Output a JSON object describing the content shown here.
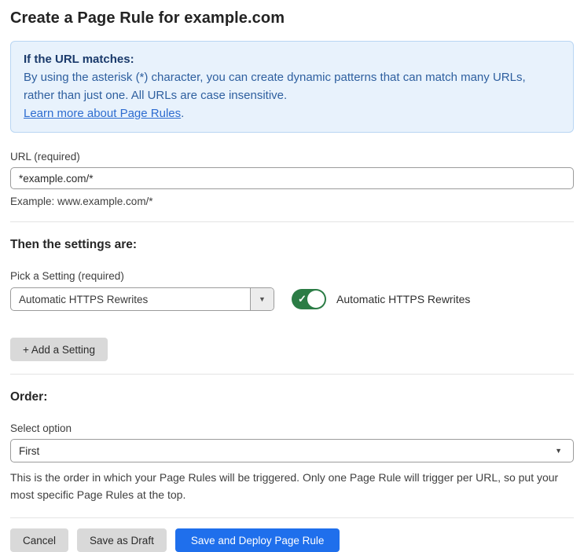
{
  "page": {
    "title": "Create a Page Rule for example.com"
  },
  "info_box": {
    "heading": "If the URL matches:",
    "body": "By using the asterisk (*) character, you can create dynamic patterns that can match many URLs, rather than just one. All URLs are case insensitive.",
    "link_label": "Learn more about Page Rules",
    "link_suffix": "."
  },
  "url_field": {
    "label": "URL (required)",
    "value": "*example.com/*",
    "helper": "Example: www.example.com/*"
  },
  "settings_section": {
    "heading": "Then the settings are:",
    "picker_label": "Pick a Setting (required)",
    "picker_value": "Automatic HTTPS Rewrites",
    "toggle_state": "on",
    "toggle_label": "Automatic HTTPS Rewrites",
    "add_setting_label": "+ Add a Setting"
  },
  "order_section": {
    "heading": "Order:",
    "select_label": "Select option",
    "select_value": "First",
    "helper": "This is the order in which your Page Rules will be triggered. Only one Page Rule will trigger per URL, so put your most specific Page Rules at the top."
  },
  "actions": {
    "cancel": "Cancel",
    "save_draft": "Save as Draft",
    "save_deploy": "Save and Deploy Page Rule"
  },
  "icons": {
    "dropdown_arrow": "▼",
    "select_arrow": "▼",
    "check": "✓"
  },
  "colors": {
    "info_bg": "#e8f2fc",
    "info_border": "#b9d6f3",
    "info_heading": "#1a3a6b",
    "info_text": "#2e5f9f",
    "link_blue": "#2d6cd0",
    "toggle_green": "#2b7c45",
    "primary_blue": "#1f6fec",
    "button_gray": "#d9d9d9"
  }
}
